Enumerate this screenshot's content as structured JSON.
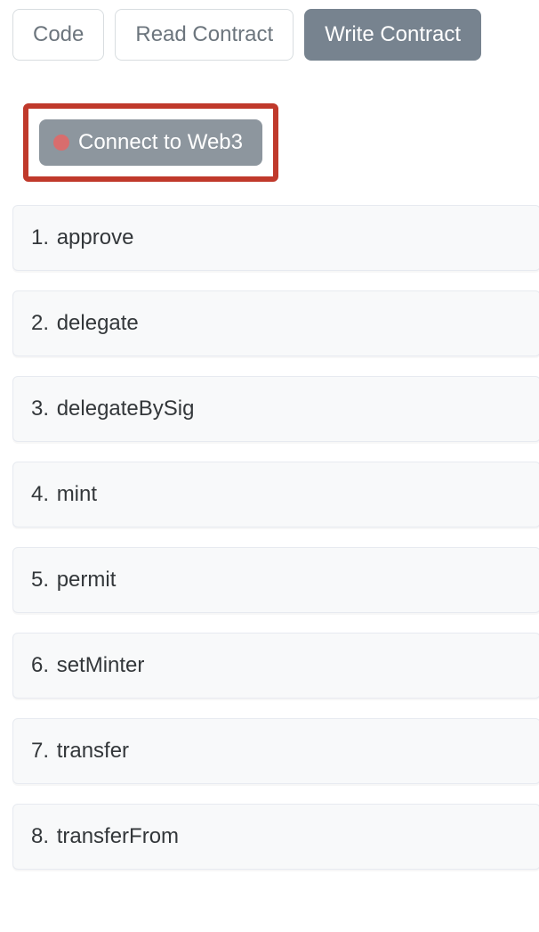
{
  "tabs": [
    {
      "label": "Code",
      "active": false
    },
    {
      "label": "Read Contract",
      "active": false
    },
    {
      "label": "Write Contract",
      "active": true
    }
  ],
  "connect": {
    "label": "Connect to Web3"
  },
  "functions": [
    {
      "index": "1.",
      "name": "approve"
    },
    {
      "index": "2.",
      "name": "delegate"
    },
    {
      "index": "3.",
      "name": "delegateBySig"
    },
    {
      "index": "4.",
      "name": "mint"
    },
    {
      "index": "5.",
      "name": "permit"
    },
    {
      "index": "6.",
      "name": "setMinter"
    },
    {
      "index": "7.",
      "name": "transfer"
    },
    {
      "index": "8.",
      "name": "transferFrom"
    }
  ]
}
